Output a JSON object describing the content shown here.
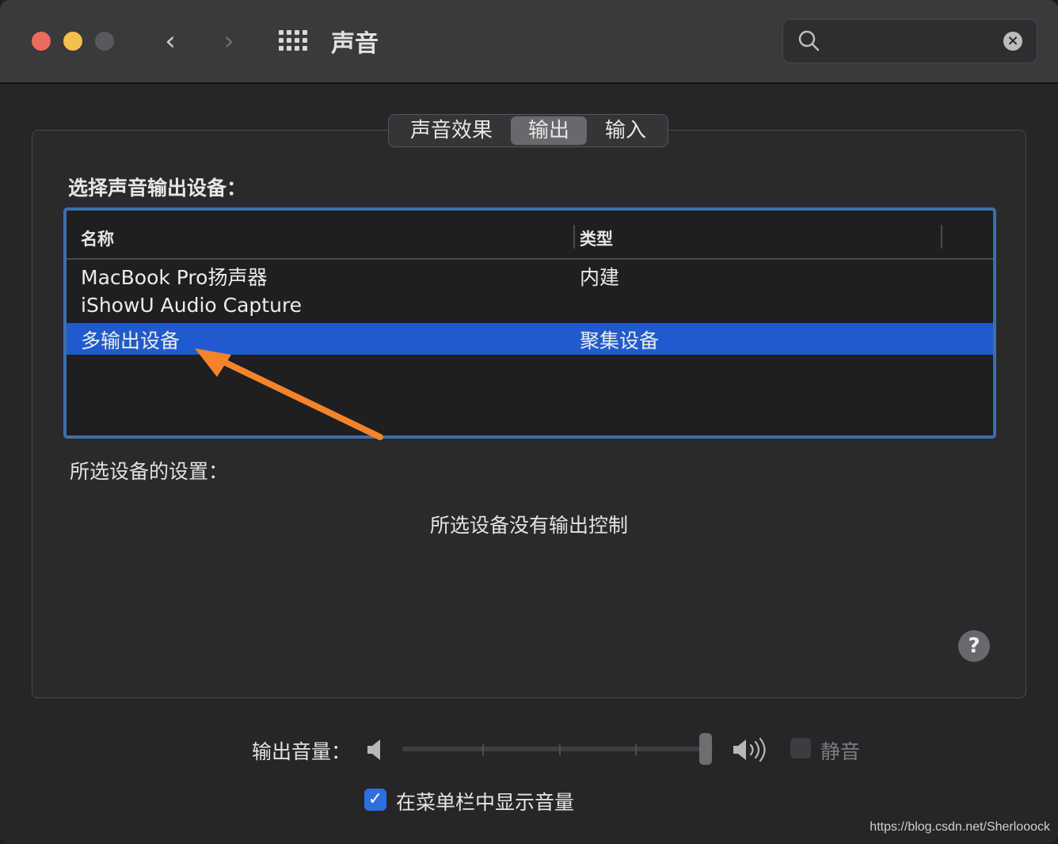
{
  "window": {
    "title": "声音"
  },
  "search": {
    "placeholder": "",
    "value": ""
  },
  "tabs": [
    {
      "label": "声音效果",
      "selected": false
    },
    {
      "label": "输出",
      "selected": true
    },
    {
      "label": "输入",
      "selected": false
    }
  ],
  "output": {
    "section_label": "选择声音输出设备：",
    "table": {
      "columns": [
        "名称",
        "类型"
      ],
      "rows": [
        {
          "name": "MacBook Pro扬声器",
          "type": "内建",
          "selected": false
        },
        {
          "name": "iShowU Audio Capture",
          "type": "",
          "selected": false
        },
        {
          "name": "多输出设备",
          "type": "聚集设备",
          "selected": true
        }
      ]
    },
    "settings_label": "所选设备的设置：",
    "no_controls_text": "所选设备没有输出控制"
  },
  "volume": {
    "label": "输出音量：",
    "level": 1.0,
    "mute_label": "静音",
    "mute_checked": false,
    "mute_enabled": false,
    "show_in_menubar_label": "在菜单栏中显示音量",
    "show_in_menubar_checked": true
  },
  "help": {
    "label": "?"
  },
  "icons": {
    "back": "chevron-left-icon",
    "forward": "chevron-right-icon",
    "show_all": "grid-icon",
    "search": "search-icon",
    "clear": "clear-icon",
    "volume_low": "speaker-low-icon",
    "volume_high": "speaker-high-icon"
  },
  "colors": {
    "selection": "#1f5bce",
    "annotation_arrow": "#f5832a",
    "table_border": "#3d6fa8"
  },
  "watermark": "https://blog.csdn.net/Sherlooock"
}
